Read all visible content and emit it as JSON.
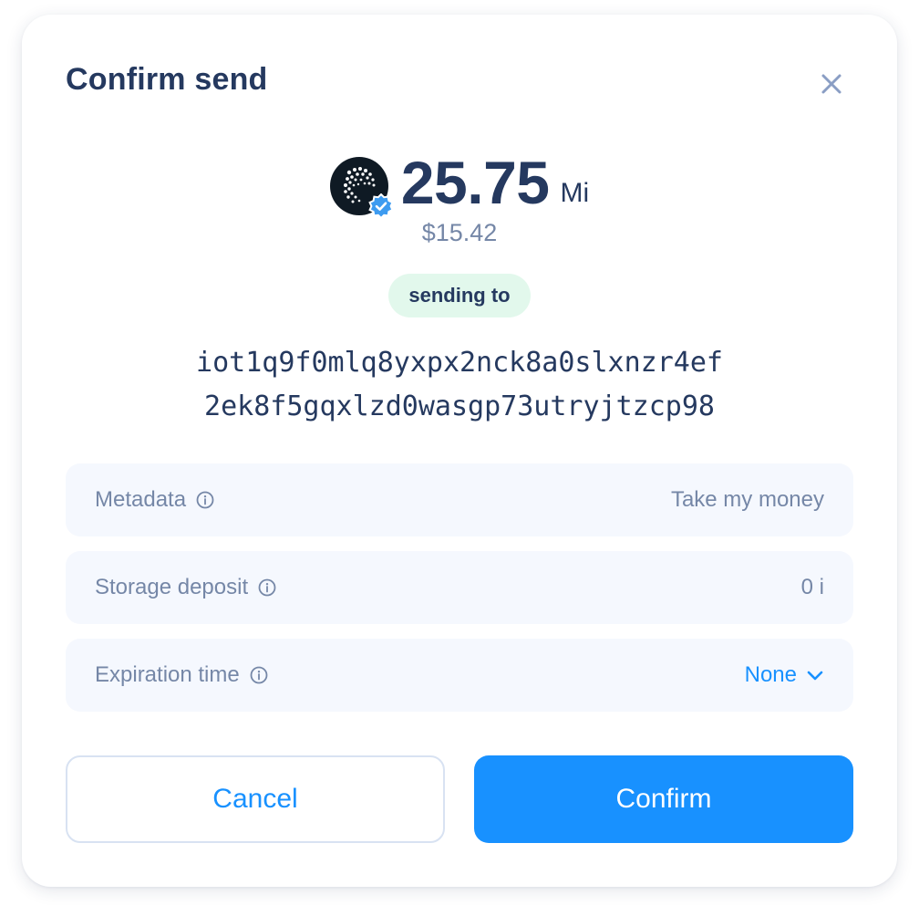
{
  "dialog": {
    "title": "Confirm send"
  },
  "amount": {
    "value": "25.75",
    "unit": "Mi",
    "fiat": "$15.42",
    "token_icon": "iota-logo-icon",
    "verified_icon": "verified-badge-icon"
  },
  "recipient": {
    "label": "sending to",
    "address_line1": "iot1q9f0mlq8yxpx2nck8a0slxnzr4ef",
    "address_line2": "2ek8f5gqxlzd0wasgp73utryjtzcp98"
  },
  "details": [
    {
      "label": "Metadata",
      "value": "Take my money",
      "icon": "info-icon"
    },
    {
      "label": "Storage deposit",
      "value": "0 i",
      "icon": "info-icon"
    },
    {
      "label": "Expiration time",
      "value": "None",
      "icon": "info-icon",
      "dropdown_icon": "chevron-down-icon"
    }
  ],
  "actions": {
    "cancel_label": "Cancel",
    "confirm_label": "Confirm"
  },
  "colors": {
    "primary": "#1891ff",
    "text_dark": "#25395f",
    "text_muted": "#7587a7",
    "badge_bg": "#e2f8ec",
    "row_bg": "#f5f8fe"
  }
}
